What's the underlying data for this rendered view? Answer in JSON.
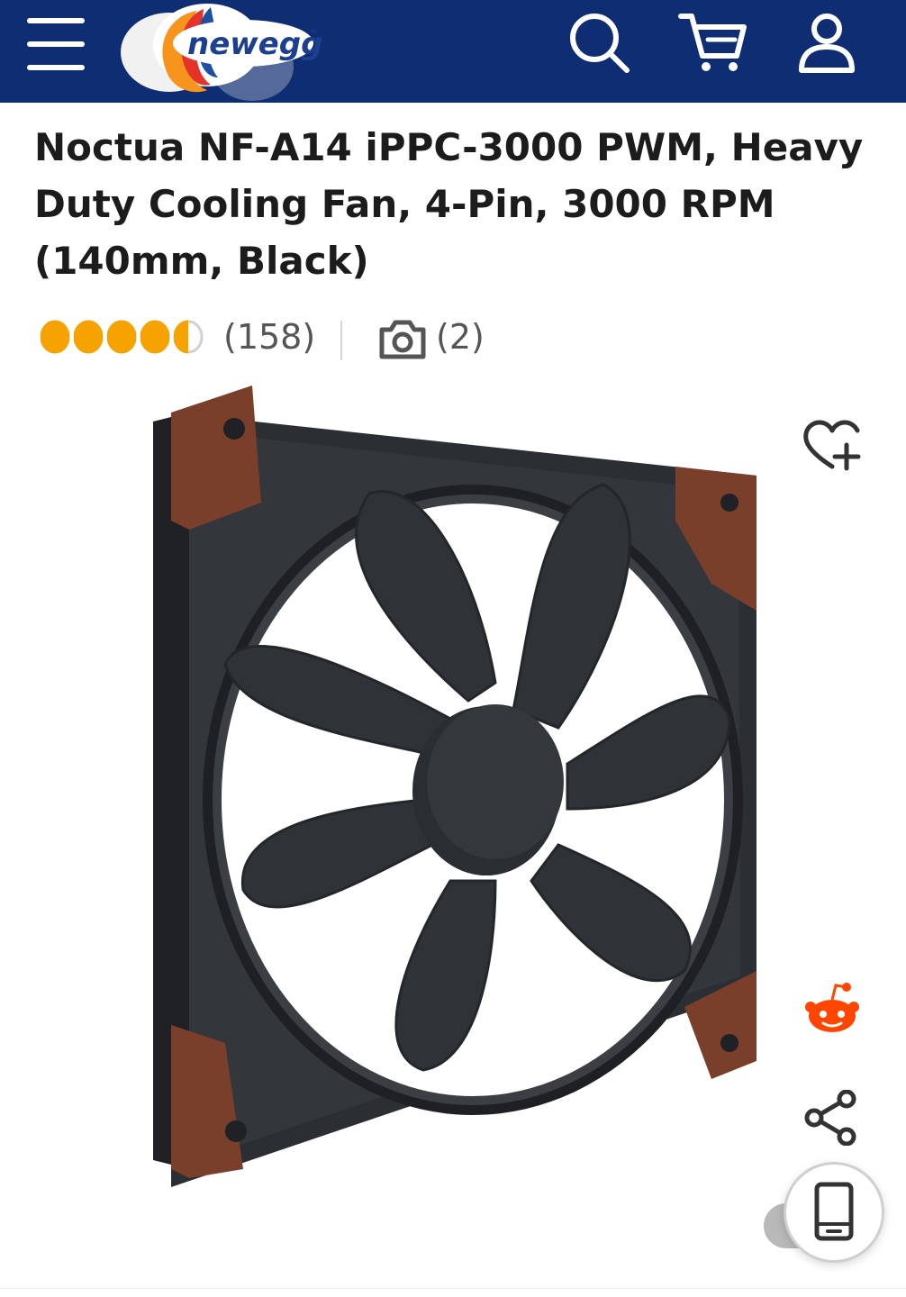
{
  "header": {
    "logo_text": "newegg",
    "logo_trademark": "®"
  },
  "product": {
    "title": "Noctua NF-A14 iPPC-3000 PWM, Heavy Duty Cooling Fan, 4-Pin, 3000 RPM (140mm, Black)",
    "rating": 4.5,
    "rating_max": 5,
    "review_count": "(158)",
    "divider": "|",
    "photo_count": "(2)"
  },
  "colors": {
    "header_bg": "#0e2d72",
    "star": "#f6a200",
    "title_text": "#1c1c1c",
    "meta_text": "#555555",
    "reddit": "#ff4500",
    "fan_frame_accent": "#7a3f2a",
    "fan_body": "#2e3135"
  },
  "icons": {
    "menu": "hamburger-icon",
    "search": "search-icon",
    "cart": "cart-icon",
    "account": "user-icon",
    "camera": "camera-icon",
    "wishlist": "heart-plus-icon",
    "reddit": "reddit-icon",
    "share": "share-icon",
    "mobile": "mobile-device-icon"
  }
}
